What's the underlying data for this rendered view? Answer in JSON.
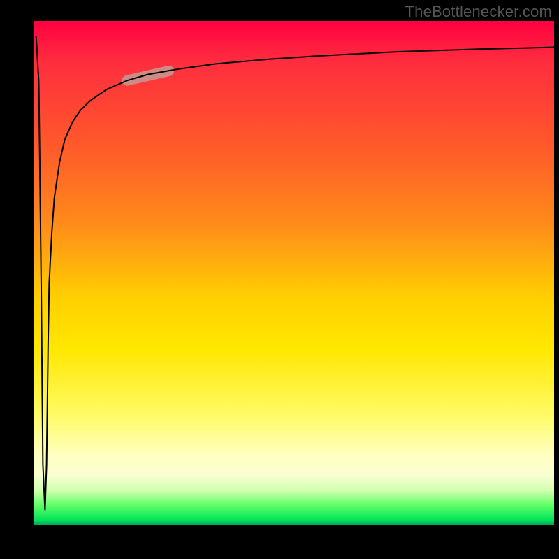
{
  "attribution": "TheBottlenecker.com",
  "chart_data": {
    "type": "line",
    "title": "",
    "xlabel": "",
    "ylabel": "",
    "xlim": [
      0,
      100
    ],
    "ylim": [
      0,
      100
    ],
    "grid": false,
    "background_gradient": {
      "direction": "vertical",
      "stops": [
        {
          "pct": 0,
          "color": "#ff0040"
        },
        {
          "pct": 25,
          "color": "#ff5a2a"
        },
        {
          "pct": 55,
          "color": "#ffd000"
        },
        {
          "pct": 85,
          "color": "#ffffc0"
        },
        {
          "pct": 96,
          "color": "#5fff66"
        },
        {
          "pct": 100,
          "color": "#009b5a"
        }
      ]
    },
    "series": [
      {
        "name": "curve",
        "color": "#000000",
        "stroke_width": 2,
        "x": [
          0.5,
          1.0,
          1.2,
          1.5,
          1.8,
          2.2,
          2.5,
          2.8,
          3.0,
          3.5,
          4.0,
          5.0,
          6.0,
          7.5,
          9.0,
          11.0,
          14.0,
          18.0,
          22.0,
          28.0,
          35.0,
          45.0,
          55.0,
          70.0,
          85.0,
          100.0
        ],
        "y": [
          97.0,
          88.0,
          72.0,
          45.0,
          12.0,
          3.0,
          12.0,
          36.0,
          48.0,
          58.0,
          65.0,
          72.0,
          76.5,
          80.0,
          82.3,
          84.3,
          86.4,
          88.2,
          89.4,
          90.5,
          91.5,
          92.4,
          93.1,
          93.9,
          94.4,
          94.8
        ]
      },
      {
        "name": "highlight-segment",
        "color": "#cd8b85",
        "stroke_width": 15,
        "linecap": "round",
        "x": [
          18.0,
          26.0
        ],
        "y": [
          88.2,
          90.1
        ]
      }
    ]
  }
}
